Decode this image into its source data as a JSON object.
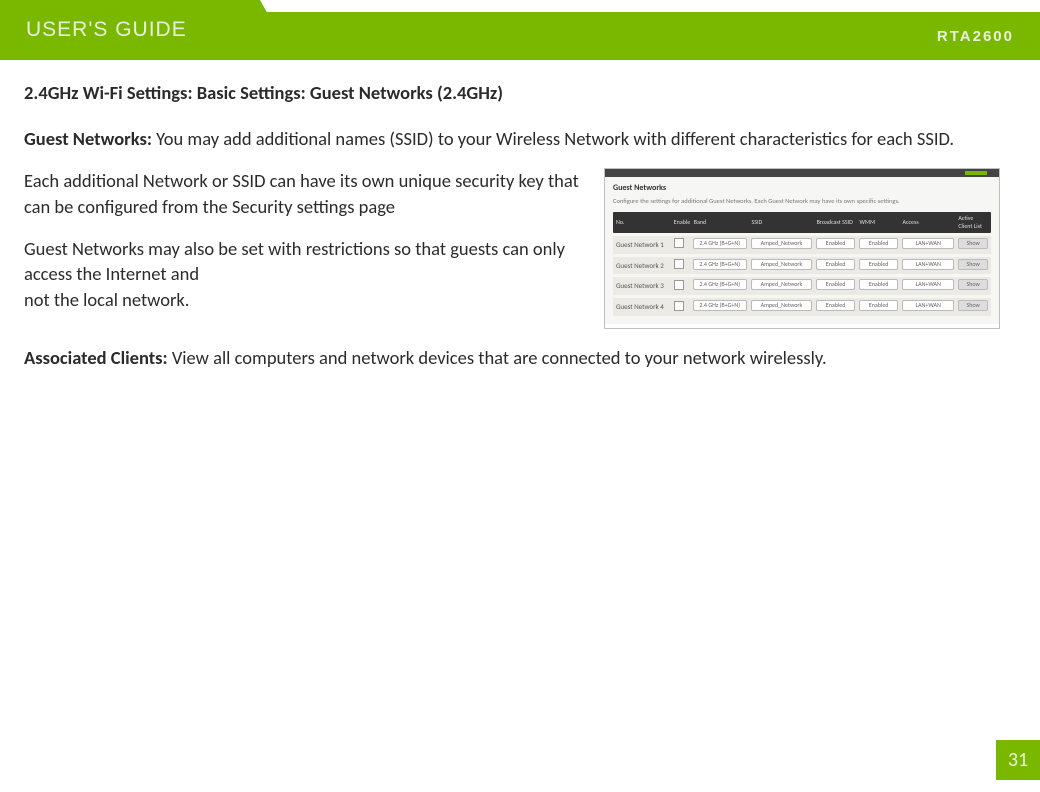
{
  "header": {
    "guide_title": "USER'S GUIDE",
    "model": "RTA2600"
  },
  "section_title": "2.4GHz Wi-Fi Settings: Basic Settings: Guest Networks (2.4GHz)",
  "para1": {
    "lead": "Guest Networks:  ",
    "rest": "You may add additional names (SSID) to your Wireless Network with different characteristics for each SSID."
  },
  "para2": "Each additional Network or SSID can have its own unique security key that can be configured from the Security settings page",
  "para3_a": "Guest Networks may also be set with restrictions so that guests can only access the Internet and",
  "para3_b": " not the local network.",
  "para4": {
    "lead": "Associated Clients: ",
    "rest": "View all computers and network devices that are connected to your network wirelessly."
  },
  "shot": {
    "title": "Guest Networks",
    "subtitle": "Configure the settings for additional Guest Networks. Each Guest Network may have its own specific settings.",
    "thead": {
      "no": "No.",
      "enable": "Enable",
      "band": "Band",
      "ssid": "SSID",
      "bcast": "Broadcast SSID",
      "wmm": "WMM",
      "access": "Access",
      "acl": "Active Client List"
    },
    "rows": [
      {
        "no": "Guest Network 1",
        "band": "2.4 GHz (B+G+N)",
        "ssid": "Amped_Network",
        "bcast": "Enabled",
        "wmm": "Enabled",
        "access": "LAN+WAN",
        "acl": "Show"
      },
      {
        "no": "Guest Network 2",
        "band": "2.4 GHz (B+G+N)",
        "ssid": "Amped_Network",
        "bcast": "Enabled",
        "wmm": "Enabled",
        "access": "LAN+WAN",
        "acl": "Show"
      },
      {
        "no": "Guest Network 3",
        "band": "2.4 GHz (B+G+N)",
        "ssid": "Amped_Network",
        "bcast": "Enabled",
        "wmm": "Enabled",
        "access": "LAN+WAN",
        "acl": "Show"
      },
      {
        "no": "Guest Network 4",
        "band": "2.4 GHz (B+G+N)",
        "ssid": "Amped_Network",
        "bcast": "Enabled",
        "wmm": "Enabled",
        "access": "LAN+WAN",
        "acl": "Show"
      }
    ]
  },
  "page_number": "31"
}
